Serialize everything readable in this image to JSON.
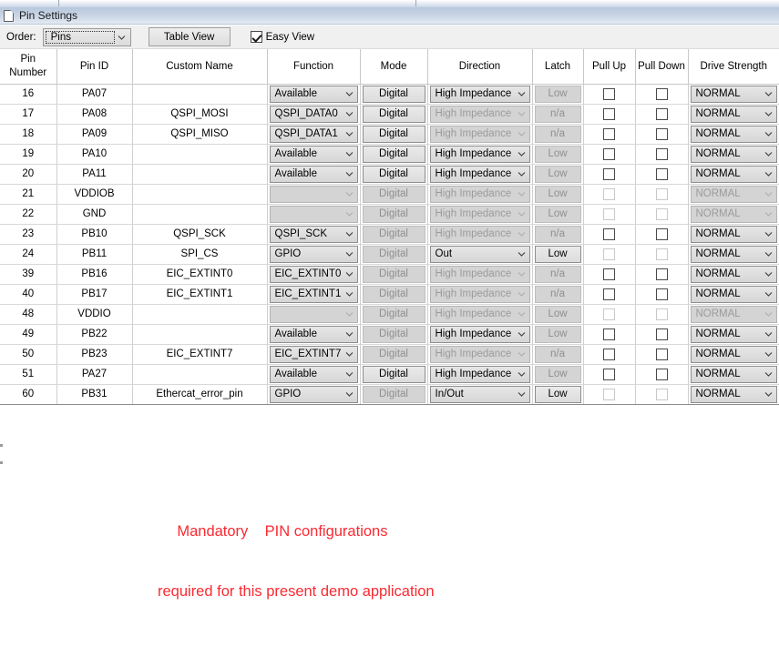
{
  "window": {
    "title": "Pin Settings",
    "icon": "document-icon"
  },
  "toolbar": {
    "order_label": "Order:",
    "order_value": "Pins",
    "order_options": [
      "Pins"
    ],
    "table_view_label": "Table View",
    "easy_view_label": "Easy View",
    "easy_view_checked": true,
    "dropdown_icon": "chevron-down-icon"
  },
  "table": {
    "columns": [
      "Pin\nNumber",
      "Pin ID",
      "Custom Name",
      "Function",
      "Mode",
      "Direction",
      "Latch",
      "Pull Up",
      "Pull Down",
      "Drive Strength"
    ],
    "rows": [
      {
        "pin_number": "16",
        "pin_id": "PA07",
        "custom_name": "",
        "function": "Available",
        "function_enabled": true,
        "mode": "Digital",
        "mode_enabled": true,
        "direction": "High Impedance",
        "direction_enabled": true,
        "latch": "Low",
        "latch_enabled": false,
        "pull_up": false,
        "pull_up_enabled": true,
        "pull_down": false,
        "pull_down_enabled": true,
        "drive_strength": "NORMAL",
        "drive_strength_enabled": true
      },
      {
        "pin_number": "17",
        "pin_id": "PA08",
        "custom_name": "QSPI_MOSI",
        "function": "QSPI_DATA0",
        "function_enabled": true,
        "mode": "Digital",
        "mode_enabled": true,
        "direction": "High Impedance",
        "direction_enabled": false,
        "latch": "n/a",
        "latch_enabled": false,
        "pull_up": false,
        "pull_up_enabled": true,
        "pull_down": false,
        "pull_down_enabled": true,
        "drive_strength": "NORMAL",
        "drive_strength_enabled": true
      },
      {
        "pin_number": "18",
        "pin_id": "PA09",
        "custom_name": "QSPI_MISO",
        "function": "QSPI_DATA1",
        "function_enabled": true,
        "mode": "Digital",
        "mode_enabled": true,
        "direction": "High Impedance",
        "direction_enabled": false,
        "latch": "n/a",
        "latch_enabled": false,
        "pull_up": false,
        "pull_up_enabled": true,
        "pull_down": false,
        "pull_down_enabled": true,
        "drive_strength": "NORMAL",
        "drive_strength_enabled": true
      },
      {
        "pin_number": "19",
        "pin_id": "PA10",
        "custom_name": "",
        "function": "Available",
        "function_enabled": true,
        "mode": "Digital",
        "mode_enabled": true,
        "direction": "High Impedance",
        "direction_enabled": true,
        "latch": "Low",
        "latch_enabled": false,
        "pull_up": false,
        "pull_up_enabled": true,
        "pull_down": false,
        "pull_down_enabled": true,
        "drive_strength": "NORMAL",
        "drive_strength_enabled": true
      },
      {
        "pin_number": "20",
        "pin_id": "PA11",
        "custom_name": "",
        "function": "Available",
        "function_enabled": true,
        "mode": "Digital",
        "mode_enabled": true,
        "direction": "High Impedance",
        "direction_enabled": true,
        "latch": "Low",
        "latch_enabled": false,
        "pull_up": false,
        "pull_up_enabled": true,
        "pull_down": false,
        "pull_down_enabled": true,
        "drive_strength": "NORMAL",
        "drive_strength_enabled": true
      },
      {
        "pin_number": "21",
        "pin_id": "VDDIOB",
        "custom_name": "",
        "function": "",
        "function_enabled": false,
        "mode": "Digital",
        "mode_enabled": false,
        "direction": "High Impedance",
        "direction_enabled": false,
        "latch": "Low",
        "latch_enabled": false,
        "pull_up": false,
        "pull_up_enabled": false,
        "pull_down": false,
        "pull_down_enabled": false,
        "drive_strength": "NORMAL",
        "drive_strength_enabled": false
      },
      {
        "pin_number": "22",
        "pin_id": "GND",
        "custom_name": "",
        "function": "",
        "function_enabled": false,
        "mode": "Digital",
        "mode_enabled": false,
        "direction": "High Impedance",
        "direction_enabled": false,
        "latch": "Low",
        "latch_enabled": false,
        "pull_up": false,
        "pull_up_enabled": false,
        "pull_down": false,
        "pull_down_enabled": false,
        "drive_strength": "NORMAL",
        "drive_strength_enabled": false
      },
      {
        "pin_number": "23",
        "pin_id": "PB10",
        "custom_name": "QSPI_SCK",
        "function": "QSPI_SCK",
        "function_enabled": true,
        "mode": "Digital",
        "mode_enabled": false,
        "direction": "High Impedance",
        "direction_enabled": false,
        "latch": "n/a",
        "latch_enabled": false,
        "pull_up": false,
        "pull_up_enabled": true,
        "pull_down": false,
        "pull_down_enabled": true,
        "drive_strength": "NORMAL",
        "drive_strength_enabled": true
      },
      {
        "pin_number": "24",
        "pin_id": "PB11",
        "custom_name": "SPI_CS",
        "function": "GPIO",
        "function_enabled": true,
        "mode": "Digital",
        "mode_enabled": false,
        "direction": "Out",
        "direction_enabled": true,
        "latch": "Low",
        "latch_enabled": true,
        "pull_up": false,
        "pull_up_enabled": false,
        "pull_down": false,
        "pull_down_enabled": false,
        "drive_strength": "NORMAL",
        "drive_strength_enabled": true
      },
      {
        "pin_number": "39",
        "pin_id": "PB16",
        "custom_name": "EIC_EXTINT0",
        "function": "EIC_EXTINT0",
        "function_enabled": true,
        "mode": "Digital",
        "mode_enabled": false,
        "direction": "High Impedance",
        "direction_enabled": false,
        "latch": "n/a",
        "latch_enabled": false,
        "pull_up": false,
        "pull_up_enabled": true,
        "pull_down": false,
        "pull_down_enabled": true,
        "drive_strength": "NORMAL",
        "drive_strength_enabled": true
      },
      {
        "pin_number": "40",
        "pin_id": "PB17",
        "custom_name": "EIC_EXTINT1",
        "function": "EIC_EXTINT1",
        "function_enabled": true,
        "mode": "Digital",
        "mode_enabled": false,
        "direction": "High Impedance",
        "direction_enabled": false,
        "latch": "n/a",
        "latch_enabled": false,
        "pull_up": false,
        "pull_up_enabled": true,
        "pull_down": false,
        "pull_down_enabled": true,
        "drive_strength": "NORMAL",
        "drive_strength_enabled": true
      },
      {
        "pin_number": "48",
        "pin_id": "VDDIO",
        "custom_name": "",
        "function": "",
        "function_enabled": false,
        "mode": "Digital",
        "mode_enabled": false,
        "direction": "High Impedance",
        "direction_enabled": false,
        "latch": "Low",
        "latch_enabled": false,
        "pull_up": false,
        "pull_up_enabled": false,
        "pull_down": false,
        "pull_down_enabled": false,
        "drive_strength": "NORMAL",
        "drive_strength_enabled": false
      },
      {
        "pin_number": "49",
        "pin_id": "PB22",
        "custom_name": "",
        "function": "Available",
        "function_enabled": true,
        "mode": "Digital",
        "mode_enabled": false,
        "direction": "High Impedance",
        "direction_enabled": true,
        "latch": "Low",
        "latch_enabled": false,
        "pull_up": false,
        "pull_up_enabled": true,
        "pull_down": false,
        "pull_down_enabled": true,
        "drive_strength": "NORMAL",
        "drive_strength_enabled": true
      },
      {
        "pin_number": "50",
        "pin_id": "PB23",
        "custom_name": "EIC_EXTINT7",
        "function": "EIC_EXTINT7",
        "function_enabled": true,
        "mode": "Digital",
        "mode_enabled": false,
        "direction": "High Impedance",
        "direction_enabled": false,
        "latch": "n/a",
        "latch_enabled": false,
        "pull_up": false,
        "pull_up_enabled": true,
        "pull_down": false,
        "pull_down_enabled": true,
        "drive_strength": "NORMAL",
        "drive_strength_enabled": true
      },
      {
        "pin_number": "51",
        "pin_id": "PA27",
        "custom_name": "",
        "function": "Available",
        "function_enabled": true,
        "mode": "Digital",
        "mode_enabled": true,
        "direction": "High Impedance",
        "direction_enabled": true,
        "latch": "Low",
        "latch_enabled": false,
        "pull_up": false,
        "pull_up_enabled": true,
        "pull_down": false,
        "pull_down_enabled": true,
        "drive_strength": "NORMAL",
        "drive_strength_enabled": true
      },
      {
        "pin_number": "60",
        "pin_id": "PB31",
        "custom_name": "Ethercat_error_pin",
        "function": "GPIO",
        "function_enabled": true,
        "mode": "Digital",
        "mode_enabled": false,
        "direction": "In/Out",
        "direction_enabled": true,
        "latch": "Low",
        "latch_enabled": true,
        "pull_up": false,
        "pull_up_enabled": false,
        "pull_down": false,
        "pull_down_enabled": false,
        "drive_strength": "NORMAL",
        "drive_strength_enabled": true
      }
    ]
  },
  "annotation": {
    "line1": "Mandatory    PIN configurations",
    "line2": "required for this present demo application",
    "color": "#fa2a32"
  }
}
